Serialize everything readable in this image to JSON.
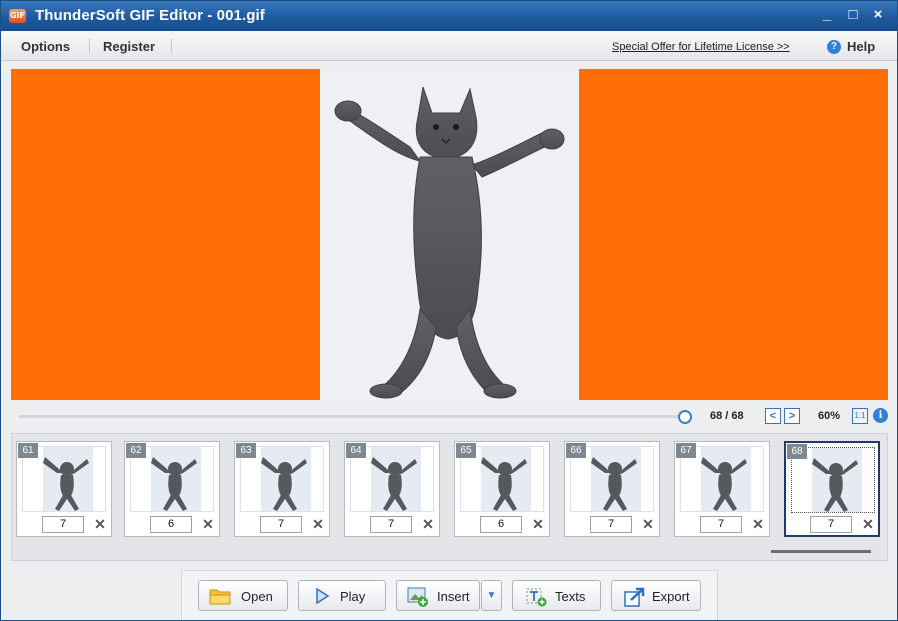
{
  "window": {
    "icon_text": "GIF",
    "title": "ThunderSoft GIF Editor - 001.gif",
    "controls": {
      "minimize": "_",
      "maximize": "□",
      "close": "×"
    }
  },
  "menubar": {
    "options": "Options",
    "register": "Register",
    "offer": "Special Offer for Lifetime License >>",
    "help": "Help"
  },
  "canvas": {
    "background": "#ff6e04",
    "image": "dancing gray cat"
  },
  "playback": {
    "frame_counter": "68 / 68",
    "prev": "<",
    "next": ">",
    "zoom": "60%",
    "ratio": "1:1"
  },
  "frames": [
    {
      "number": "61",
      "delay": "7"
    },
    {
      "number": "62",
      "delay": "6"
    },
    {
      "number": "63",
      "delay": "7"
    },
    {
      "number": "64",
      "delay": "7"
    },
    {
      "number": "65",
      "delay": "6"
    },
    {
      "number": "66",
      "delay": "7"
    },
    {
      "number": "67",
      "delay": "7"
    },
    {
      "number": "68",
      "delay": "7",
      "selected": true
    }
  ],
  "toolbar": {
    "open": "Open",
    "play": "Play",
    "insert": "Insert",
    "texts": "Texts",
    "export": "Export"
  }
}
